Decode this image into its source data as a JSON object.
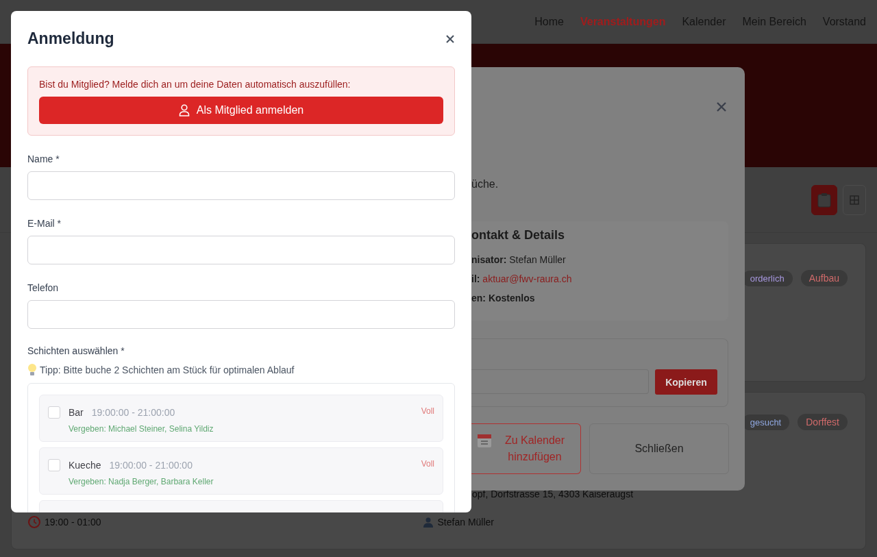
{
  "nav": {
    "links": [
      {
        "label": "Home",
        "selected": false
      },
      {
        "label": "Veranstaltungen",
        "selected": true
      },
      {
        "label": "Kalender",
        "selected": false
      },
      {
        "label": "Mein Bereich",
        "selected": false
      },
      {
        "label": "Vorstand",
        "selected": false
      }
    ]
  },
  "page": {
    "view_buttons": [
      {
        "kind": "list",
        "selected": true
      },
      {
        "kind": "grid",
        "selected": false
      }
    ],
    "events": [
      {
        "badges": [
          {
            "label": "orderlich",
            "color": "#a898e0"
          },
          {
            "label": "Aufbau",
            "color": "#d06a6a"
          }
        ]
      },
      {
        "badges": [
          {
            "label": "gesucht",
            "color": "#90a8e0"
          },
          {
            "label": "Dorffest",
            "color": "#d06a6a"
          }
        ],
        "address": "opf, Dorfstrasse 15, 4303 Kaiseraugst",
        "time": "19:00 - 01:00",
        "organizer": "Stefan Müller"
      }
    ]
  },
  "detail_modal": {
    "description": "üche.",
    "contact_heading": "ontakt & Details",
    "details": [
      {
        "label": "nisator:",
        "value": "Stefan Müller",
        "kind": "text"
      },
      {
        "label": "il:",
        "value": "aktuar@fwv-raura.ch",
        "kind": "link"
      },
      {
        "label": "en:",
        "value": "Kostenlos",
        "kind": "bold"
      }
    ],
    "copy_button": "Kopieren",
    "calendar_button": "Zu Kalender hinzufügen",
    "close_button": "Schließen"
  },
  "signup_modal": {
    "title": "Anmeldung",
    "member_prompt": "Bist du Mitglied? Melde dich an um deine Daten automatisch auszufüllen:",
    "member_button": "Als Mitglied anmelden",
    "fields": [
      {
        "label": "Name *"
      },
      {
        "label": "E-Mail *"
      },
      {
        "label": "Telefon"
      }
    ],
    "shifts_label": "Schichten auswählen *",
    "tip": "Tipp: Bitte buche 2 Schichten am Stück für optimalen Ablauf",
    "shifts": [
      {
        "role": "Bar",
        "time": "19:00:00 - 21:00:00",
        "assigned": "Vergeben: Michael Steiner, Selina Yildiz",
        "status": "Voll",
        "checked": false
      },
      {
        "role": "Kueche",
        "time": "19:00:00 - 21:00:00",
        "assigned": "Vergeben: Nadja Berger, Barbara Keller",
        "status": "Voll",
        "checked": false
      }
    ]
  }
}
